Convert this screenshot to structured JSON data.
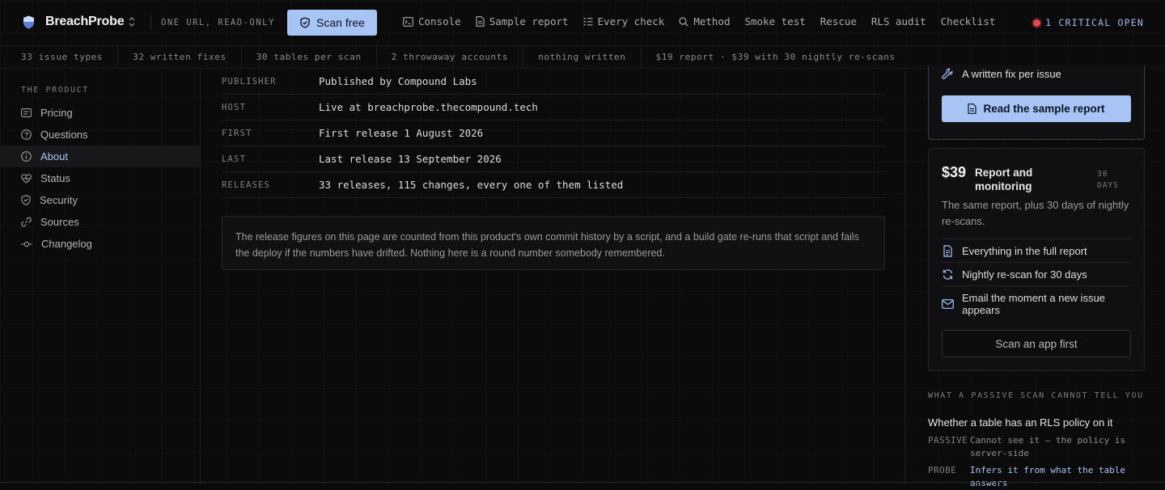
{
  "brand": {
    "name": "BreachProbe",
    "tagline": "ONE URL, READ-ONLY"
  },
  "header": {
    "scan_label": "Scan free",
    "nav": [
      {
        "label": "Console",
        "icon": "terminal-icon"
      },
      {
        "label": "Sample report",
        "icon": "document-icon"
      },
      {
        "label": "Every check",
        "icon": "checklist-icon"
      },
      {
        "label": "Method",
        "icon": "search-icon"
      },
      {
        "label": "Smoke test",
        "icon": ""
      },
      {
        "label": "Rescue",
        "icon": ""
      },
      {
        "label": "RLS audit",
        "icon": ""
      },
      {
        "label": "Checklist",
        "icon": ""
      }
    ],
    "critical": "1 CRITICAL OPEN",
    "critical_color": "#e5484d"
  },
  "stats": [
    "33 issue types",
    "32 written fixes",
    "30 tables per scan",
    "2 throwaway accounts",
    "nothing written",
    "$19 report · $39 with 30 nightly re-scans"
  ],
  "sidebar": {
    "heading": "THE PRODUCT",
    "items": [
      {
        "label": "Pricing",
        "icon": "receipt-icon"
      },
      {
        "label": "Questions",
        "icon": "question-icon"
      },
      {
        "label": "About",
        "icon": "info-icon",
        "active": true
      },
      {
        "label": "Status",
        "icon": "heartbeat-icon"
      },
      {
        "label": "Security",
        "icon": "shield-icon"
      },
      {
        "label": "Sources",
        "icon": "link-icon"
      },
      {
        "label": "Changelog",
        "icon": "commit-icon"
      }
    ]
  },
  "main": {
    "rows": [
      {
        "key": "PUBLISHER",
        "value": "Published by Compound Labs"
      },
      {
        "key": "HOST",
        "value": "Live at breachprobe.thecompound.tech"
      },
      {
        "key": "FIRST",
        "value": "First release 1 August 2026"
      },
      {
        "key": "LAST",
        "value": "Last release 13 September 2026"
      },
      {
        "key": "RELEASES",
        "value": "33 releases, 115 changes, every one of them listed"
      }
    ],
    "note": "The release figures on this page are counted from this product's own commit history by a script, and a build gate re-runs that script and fails the deploy if the numbers have drifted. Nothing here is a round number somebody remembered."
  },
  "right": {
    "card1": {
      "feature": "A written fix per issue",
      "button": "Read the sample report"
    },
    "card2": {
      "price": "$39",
      "name": "Report and monitoring",
      "days": "30 DAYS",
      "desc": "The same report, plus 30 days of nightly re-scans.",
      "features": [
        {
          "label": "Everything in the full report",
          "icon": "report-icon"
        },
        {
          "label": "Nightly re-scan for 30 days",
          "icon": "refresh-icon"
        },
        {
          "label": "Email the moment a new issue appears",
          "icon": "mail-icon"
        }
      ],
      "button": "Scan an app first"
    },
    "passive": {
      "heading": "WHAT A PASSIVE SCAN CANNOT TELL YOU",
      "question": "Whether a table has an RLS policy on it",
      "rows": [
        {
          "key": "PASSIVE",
          "value": "Cannot see it — the policy is server-side"
        },
        {
          "key": "PROBE",
          "value": "Infers it from what the table answers"
        }
      ]
    }
  },
  "accent": "#a7c4f5"
}
